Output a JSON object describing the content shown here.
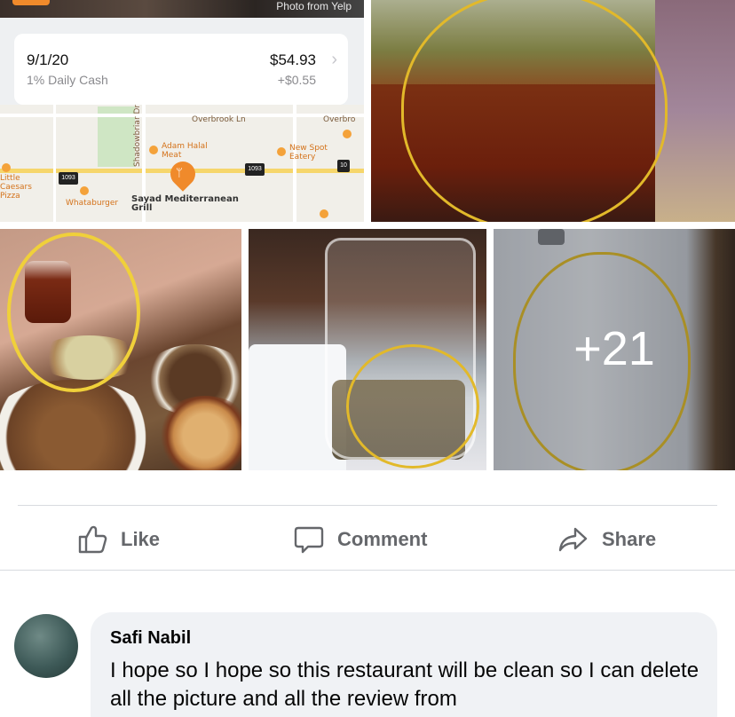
{
  "map_tile": {
    "photo_caption": "Photo from Yelp",
    "transaction": {
      "date": "9/1/20",
      "subtitle": "1% Daily Cash",
      "amount": "$54.93",
      "cash_back": "+$0.55"
    },
    "map_labels": {
      "road_overbrook": "Overbrook Ln",
      "road_overbrook_2": "Overbro",
      "road_shadowbriar": "Shadowbriar Dr",
      "adam_halal": "Adam Halal Meat",
      "new_spot": "New Spot Eatery",
      "little_caesars": "Little Caesars Pizza",
      "whataburger": "Whataburger",
      "sayad": "Sayad Mediterranean Grill",
      "hwy_1": "1093",
      "hwy_2": "1093",
      "hwy_3": "10"
    }
  },
  "photo_grid": {
    "more_count": "+21"
  },
  "actions": {
    "like": "Like",
    "comment": "Comment",
    "share": "Share"
  },
  "comment": {
    "author": "Safi Nabil",
    "text": "I hope so I hope so this restaurant will be clean so I can delete all the picture and all the review from"
  },
  "colors": {
    "brand_orange": "#f08a2b",
    "annotation_yellow": "#e2b92a",
    "action_gray": "#65676b",
    "bubble_bg": "#f0f2f5"
  }
}
